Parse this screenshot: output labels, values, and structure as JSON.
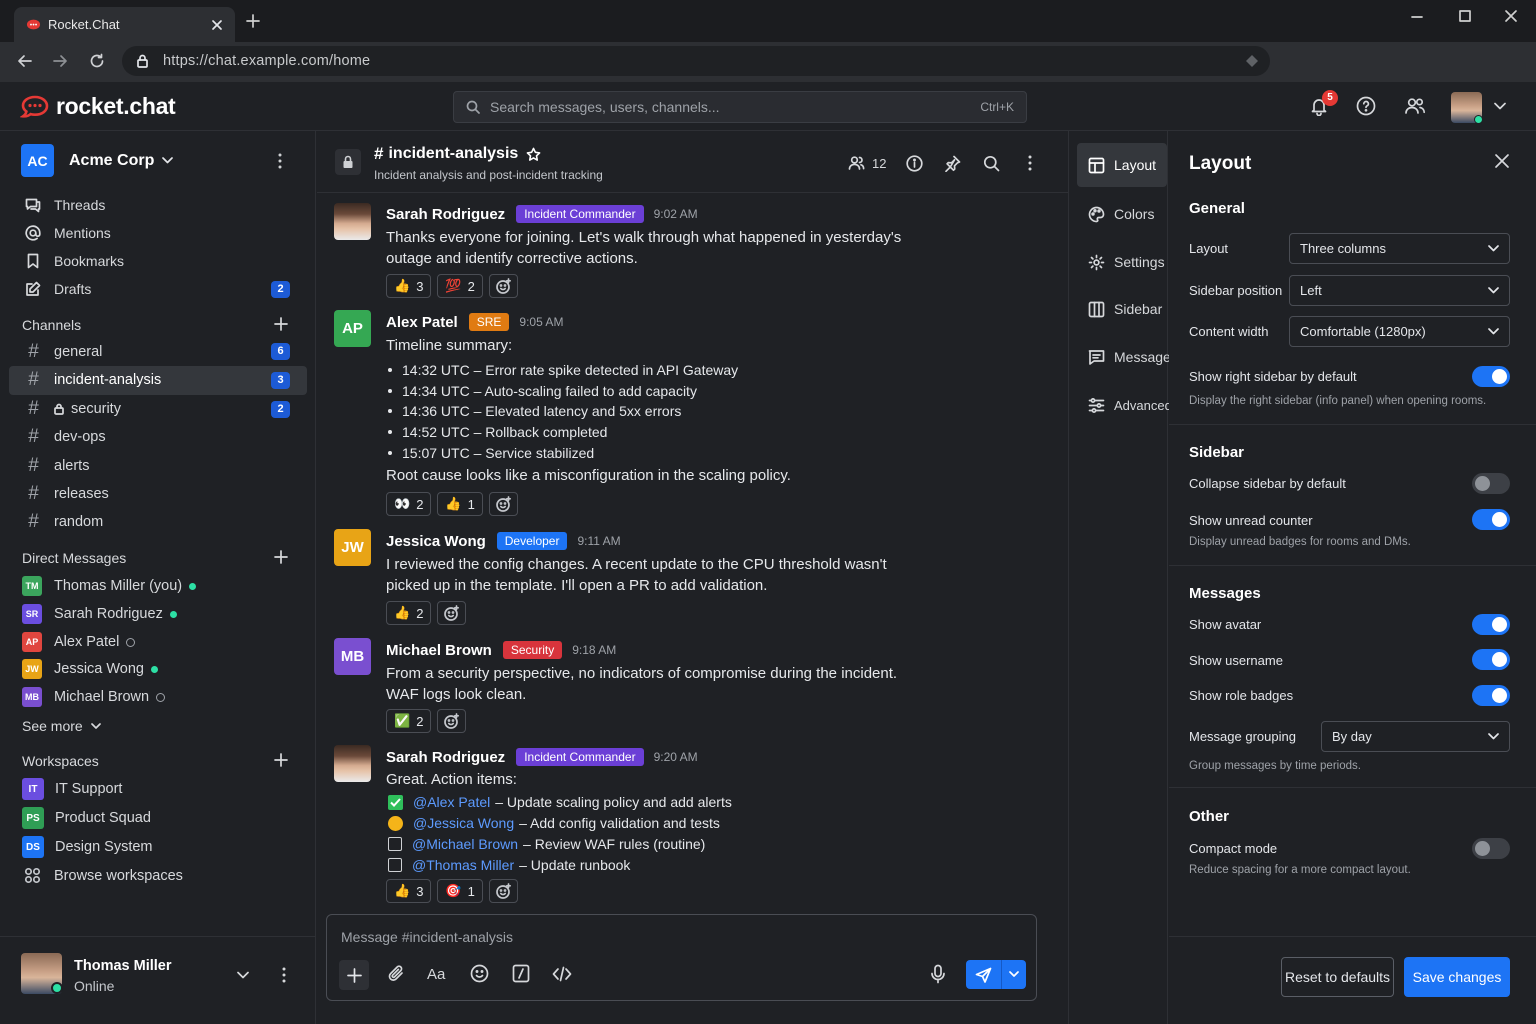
{
  "browser": {
    "tab_title": "Rocket.Chat",
    "url": "https://chat.example.com/home"
  },
  "app": {
    "logo_text": "rocket.chat",
    "search_placeholder": "Search messages, users, channels...",
    "search_shortcut": "Ctrl+K",
    "notification_count": "5",
    "accent_color": "#1d74f5"
  },
  "workspace": {
    "initials": "AC",
    "name": "Acme Corp"
  },
  "nav": [
    {
      "label": "Threads",
      "icon": "threads-icon"
    },
    {
      "label": "Mentions",
      "icon": "at-icon"
    },
    {
      "label": "Bookmarks",
      "icon": "bookmark-icon"
    },
    {
      "label": "Drafts",
      "icon": "drafts-icon",
      "count": "2"
    }
  ],
  "channels": {
    "header": "Channels",
    "items": [
      {
        "name": "general",
        "count": "6"
      },
      {
        "name": "incident-analysis",
        "count": "3",
        "selected": true
      },
      {
        "name": "security",
        "count": "2",
        "private": true
      },
      {
        "name": "dev-ops"
      },
      {
        "name": "alerts"
      },
      {
        "name": "releases"
      },
      {
        "name": "random"
      }
    ]
  },
  "direct_messages": {
    "header": "Direct Messages",
    "items": [
      {
        "initials": "TM",
        "name": "Thomas Miller (you)",
        "status": "online",
        "color": "#3ba55d"
      },
      {
        "initials": "SR",
        "name": "Sarah Rodriguez",
        "status": "online",
        "color": "#6b4ee0"
      },
      {
        "initials": "AP",
        "name": "Alex Patel",
        "status": "offline",
        "color": "#e0463f"
      },
      {
        "initials": "JW",
        "name": "Jessica Wong",
        "status": "online",
        "color": "#e8a416"
      },
      {
        "initials": "MB",
        "name": "Michael Brown",
        "status": "offline",
        "color": "#7a4fd0"
      }
    ],
    "see_more": "See more"
  },
  "workspaces": {
    "header": "Workspaces",
    "items": [
      {
        "initials": "IT",
        "name": "IT Support",
        "color": "#6b4ee0"
      },
      {
        "initials": "PS",
        "name": "Product Squad",
        "color": "#2f9e55"
      },
      {
        "initials": "DS",
        "name": "Design System",
        "color": "#1d74f5"
      }
    ],
    "browse": "Browse workspaces"
  },
  "current_user": {
    "name": "Thomas Miller",
    "status": "Online"
  },
  "room": {
    "name": "incident-analysis",
    "topic": "Incident analysis and post-incident tracking",
    "member_count": "12"
  },
  "messages": [
    {
      "user": "Sarah Rodriguez",
      "role": "Incident Commander",
      "role_color": "#6b3fd6",
      "time": "9:02 AM",
      "lines": [
        "Thanks everyone for joining. Let's walk through what happened in yesterday's",
        "outage and identify corrective actions."
      ],
      "reactions": [
        {
          "emoji": "👍",
          "count": "3"
        },
        {
          "emoji": "💯",
          "count": "2"
        }
      ]
    },
    {
      "user": "Alex Patel",
      "initials": "AP",
      "role": "SRE",
      "role_color": "#e07b12",
      "time": "9:05 AM",
      "intro": "Timeline summary:",
      "bullets": [
        "14:32 UTC – Error rate spike detected in API Gateway",
        "14:34 UTC – Auto-scaling failed to add capacity",
        "14:36 UTC – Elevated latency and 5xx errors",
        "14:52 UTC – Rollback completed",
        "15:07 UTC – Service stabilized"
      ],
      "outro": "Root cause looks like a misconfiguration in the scaling policy.",
      "reactions": [
        {
          "emoji": "👀",
          "count": "2"
        },
        {
          "emoji": "👍",
          "count": "1"
        }
      ]
    },
    {
      "user": "Jessica Wong",
      "initials": "JW",
      "role": "Developer",
      "role_color": "#1d74f5",
      "time": "9:11 AM",
      "lines": [
        "I reviewed the config changes. A recent update to the CPU threshold wasn't",
        "picked up in the template. I'll open a PR to add validation."
      ],
      "reactions": [
        {
          "emoji": "👍",
          "count": "2"
        }
      ]
    },
    {
      "user": "Michael Brown",
      "initials": "MB",
      "role": "Security",
      "role_color": "#d8343c",
      "time": "9:18 AM",
      "lines": [
        "From a security perspective, no indicators of compromise during the incident.",
        "WAF logs look clean."
      ],
      "reactions": [
        {
          "emoji": "✅",
          "count": "2"
        }
      ]
    },
    {
      "user": "Sarah Rodriguez",
      "role": "Incident Commander",
      "role_color": "#6b3fd6",
      "time": "9:20 AM",
      "intro": "Great. Action items:",
      "todos": [
        {
          "state": "done",
          "mention": "@Alex Patel",
          "text": "– Update scaling policy and add alerts"
        },
        {
          "state": "progress",
          "mention": "@Jessica Wong",
          "text": "– Add config validation and tests"
        },
        {
          "state": "open",
          "mention": "@Michael Brown",
          "text": "– Review WAF rules (routine)"
        },
        {
          "state": "open",
          "mention": "@Thomas Miller",
          "text": "– Update runbook"
        }
      ],
      "reactions": [
        {
          "emoji": "👍",
          "count": "3"
        },
        {
          "emoji": "🎯",
          "count": "1"
        }
      ]
    }
  ],
  "composer": {
    "placeholder": "Message #incident-analysis",
    "format_label": "Aa"
  },
  "settings_nav": [
    {
      "label": "Layout",
      "icon": "layout-icon",
      "active": true
    },
    {
      "label": "Colors",
      "icon": "palette-icon"
    },
    {
      "label": "Settings",
      "icon": "gear-icon"
    },
    {
      "label": "Sidebar",
      "icon": "sidebar-icon"
    },
    {
      "label": "Message",
      "icon": "message-icon"
    },
    {
      "label": "Advanced",
      "icon": "sliders-icon"
    }
  ],
  "settings": {
    "title": "Layout",
    "general": {
      "header": "General",
      "layout_label": "Layout",
      "layout_value": "Three columns",
      "sidebar_position_label": "Sidebar position",
      "sidebar_position_value": "Left",
      "content_width_label": "Content width",
      "content_width_value": "Comfortable (1280px)",
      "show_right_sidebar_label": "Show right sidebar by default",
      "show_right_sidebar": true,
      "show_right_sidebar_desc": "Display the right sidebar (info panel) when opening rooms."
    },
    "sidebar": {
      "header": "Sidebar",
      "collapse_label": "Collapse sidebar by default",
      "collapse": false,
      "unread_label": "Show unread counter",
      "unread": true,
      "unread_desc": "Display unread badges for rooms and DMs."
    },
    "messages": {
      "header": "Messages",
      "avatar_label": "Show avatar",
      "avatar": true,
      "username_label": "Show username",
      "username": true,
      "role_badges_label": "Show role badges",
      "role_badges": true,
      "grouping_label": "Message grouping",
      "grouping_value": "By day",
      "grouping_desc": "Group messages by time periods."
    },
    "other": {
      "header": "Other",
      "compact_label": "Compact mode",
      "compact": false,
      "compact_desc": "Reduce spacing for a more compact layout."
    },
    "reset_label": "Reset to defaults",
    "save_label": "Save changes"
  }
}
